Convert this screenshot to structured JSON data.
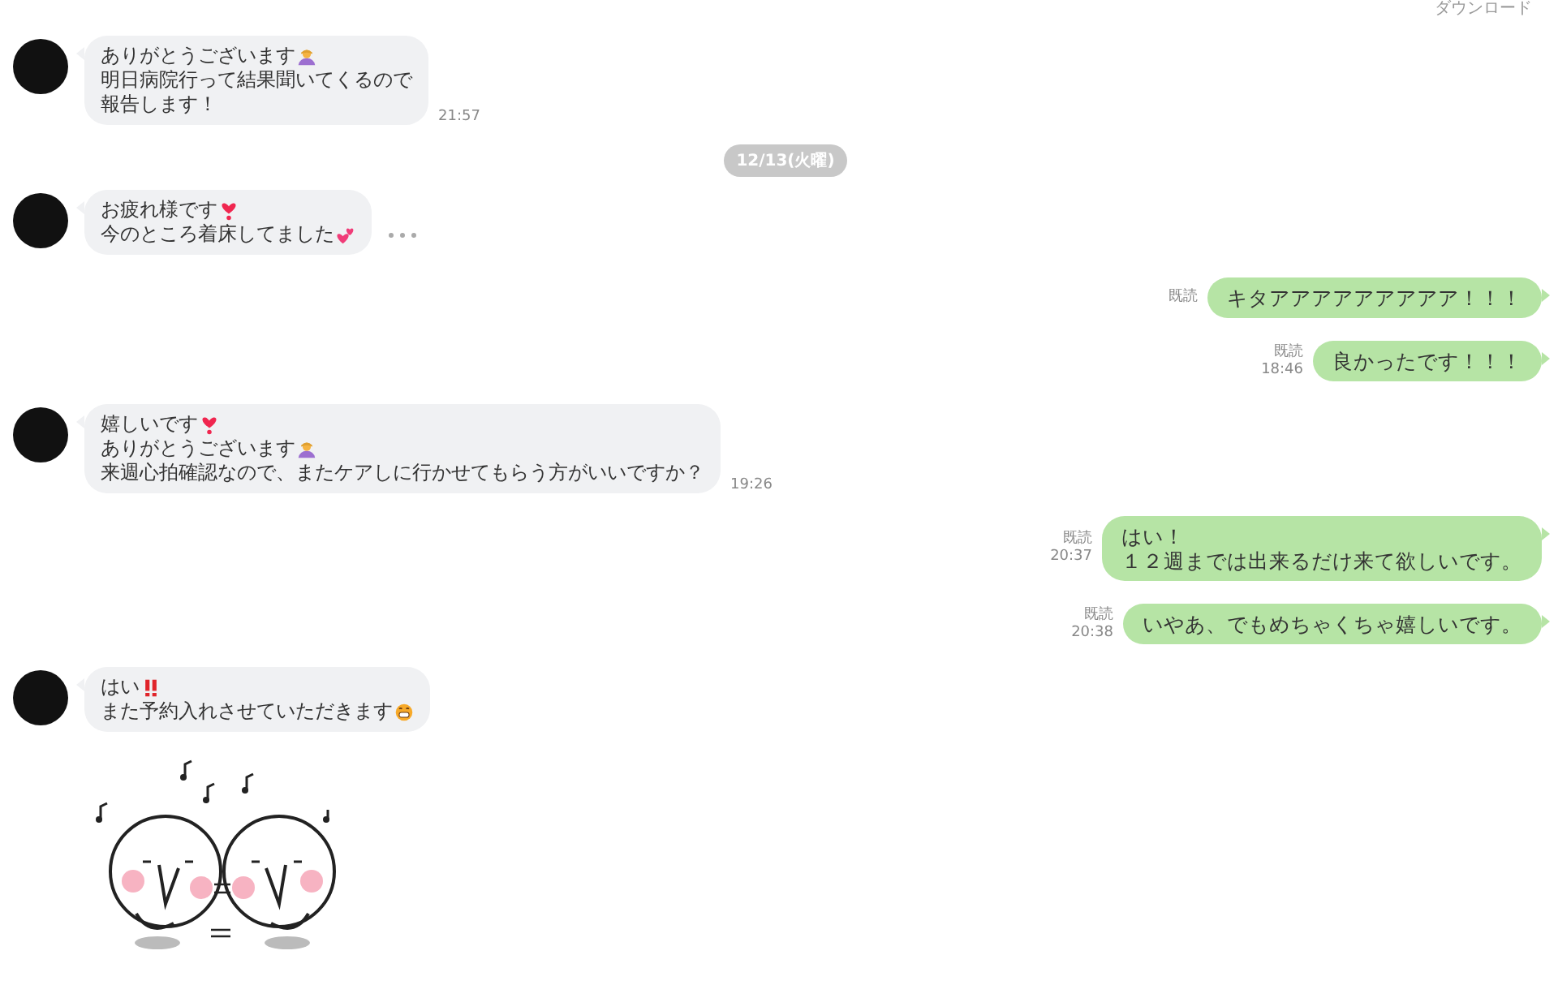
{
  "header": {
    "download": "ダウンロード"
  },
  "messages": [
    {
      "kind": "incoming",
      "lines": [
        {
          "kind": "bow",
          "text": "ありがとうございます"
        },
        {
          "kind": "plain",
          "text": "明日病院行って結果聞いてくるので"
        },
        {
          "kind": "plain",
          "text": "報告します！"
        }
      ],
      "time": "21:57"
    },
    {
      "kind": "date",
      "text": "12/13(火曜)"
    },
    {
      "kind": "incoming",
      "lines": [
        {
          "kind": "heart",
          "text": "お疲れ様です"
        },
        {
          "kind": "hearts",
          "text": "今のところ着床してました"
        }
      ],
      "more": true
    },
    {
      "kind": "outgoing",
      "read": "既読",
      "lines": [
        {
          "text": "キタアアアアアアアアア！！！"
        }
      ]
    },
    {
      "kind": "outgoing",
      "read": "既読",
      "time": "18:46",
      "lines": [
        {
          "text": "良かったです！！！"
        }
      ]
    },
    {
      "kind": "incoming",
      "lines": [
        {
          "kind": "heart",
          "text": "嬉しいです"
        },
        {
          "kind": "bow",
          "text": "ありがとうございます"
        },
        {
          "kind": "plain",
          "text": "来週心拍確認なので、またケアしに行かせてもらう方がいいですか？"
        }
      ],
      "time": "19:26"
    },
    {
      "kind": "outgoing",
      "read": "既読",
      "time": "20:37",
      "lines": [
        {
          "text": "はい！"
        },
        {
          "text": "１２週までは出来るだけ来て欲しいです。"
        }
      ]
    },
    {
      "kind": "outgoing",
      "read": "既読",
      "time": "20:38",
      "lines": [
        {
          "text": "いやあ、でもめちゃくちゃ嬉しいです。"
        }
      ]
    },
    {
      "kind": "incoming",
      "lines": [
        {
          "kind": "exclaim",
          "text": "はい"
        },
        {
          "kind": "grin",
          "text": "また予約入れさせていただきます"
        }
      ]
    },
    {
      "kind": "sticker"
    }
  ]
}
